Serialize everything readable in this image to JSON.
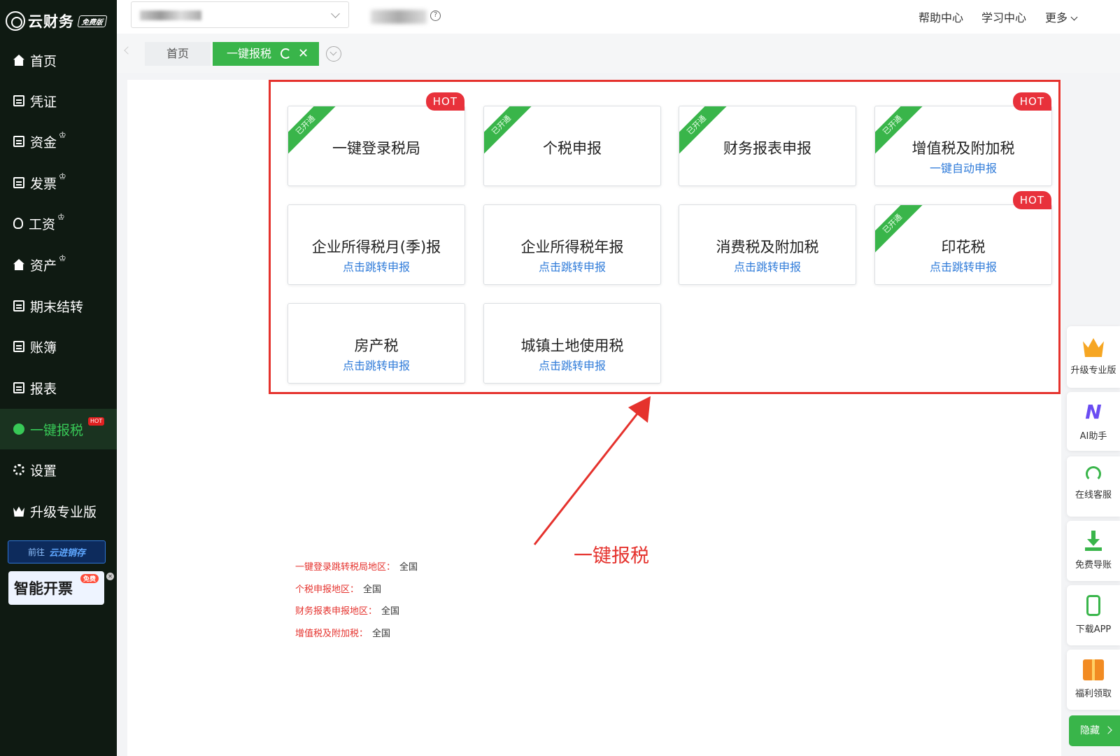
{
  "brand": {
    "name": "云财务",
    "badge": "免费版"
  },
  "sidebar": {
    "items": [
      {
        "label": "首页",
        "icon": "home-icon"
      },
      {
        "label": "凭证",
        "icon": "voucher-icon"
      },
      {
        "label": "资金",
        "icon": "fund-icon",
        "crown": true
      },
      {
        "label": "发票",
        "icon": "invoice-icon",
        "crown": true
      },
      {
        "label": "工资",
        "icon": "salary-icon",
        "crown": true
      },
      {
        "label": "资产",
        "icon": "asset-icon",
        "crown": true
      },
      {
        "label": "期末结转",
        "icon": "period-close-icon"
      },
      {
        "label": "账簿",
        "icon": "ledger-icon"
      },
      {
        "label": "报表",
        "icon": "report-icon"
      },
      {
        "label": "一键报税",
        "icon": "tax-icon",
        "active": true,
        "badge": "HOT"
      },
      {
        "label": "设置",
        "icon": "gear-icon"
      },
      {
        "label": "升级专业版",
        "icon": "crown-icon"
      }
    ],
    "promo_jxc": {
      "prefix": "前往",
      "name": "云进销存"
    },
    "promo_fp": {
      "label": "智能开票",
      "badge": "免费"
    }
  },
  "topbar": {
    "links": [
      "帮助中心",
      "学习中心",
      "更多"
    ]
  },
  "tabs": {
    "home": "首页",
    "active": "一键报税"
  },
  "cards": [
    {
      "title": "一键登录税局",
      "sub": "",
      "opened": true,
      "hot": true
    },
    {
      "title": "个税申报",
      "sub": "",
      "opened": true,
      "hot": false
    },
    {
      "title": "财务报表申报",
      "sub": "",
      "opened": true,
      "hot": false
    },
    {
      "title": "增值税及附加税",
      "sub": "一键自动申报",
      "opened": true,
      "hot": true
    },
    {
      "title": "企业所得税月(季)报",
      "sub": "点击跳转申报",
      "opened": false,
      "hot": false
    },
    {
      "title": "企业所得税年报",
      "sub": "点击跳转申报",
      "opened": false,
      "hot": false
    },
    {
      "title": "消费税及附加税",
      "sub": "点击跳转申报",
      "opened": false,
      "hot": false
    },
    {
      "title": "印花税",
      "sub": "点击跳转申报",
      "opened": true,
      "hot": true
    },
    {
      "title": "房产税",
      "sub": "点击跳转申报",
      "opened": false,
      "hot": false
    },
    {
      "title": "城镇土地使用税",
      "sub": "点击跳转申报",
      "opened": false,
      "hot": false
    }
  ],
  "labels": {
    "ribbon": "已开通",
    "hot": "HOT"
  },
  "annotation": "一键报税",
  "regions": [
    {
      "key": "一键登录跳转税局地区：",
      "value": "全国"
    },
    {
      "key": "个税申报地区：",
      "value": "全国"
    },
    {
      "key": "财务报表申报地区：",
      "value": "全国"
    },
    {
      "key": "增值税及附加税：",
      "value": "全国"
    }
  ],
  "float_tools": [
    {
      "label": "升级专业版",
      "icon": "crown-icon"
    },
    {
      "label": "AI助手",
      "icon": "ai-icon"
    },
    {
      "label": "在线客服",
      "icon": "headset-icon"
    },
    {
      "label": "免费导账",
      "icon": "download-icon"
    },
    {
      "label": "下载APP",
      "icon": "phone-icon"
    },
    {
      "label": "福利领取",
      "icon": "gift-icon"
    }
  ],
  "hide_button": "隐藏",
  "colors": {
    "brand_green": "#39b54a",
    "sidebar_bg": "#0f1a12",
    "highlight_red": "#e5322d",
    "link_blue": "#2f7bd9"
  }
}
